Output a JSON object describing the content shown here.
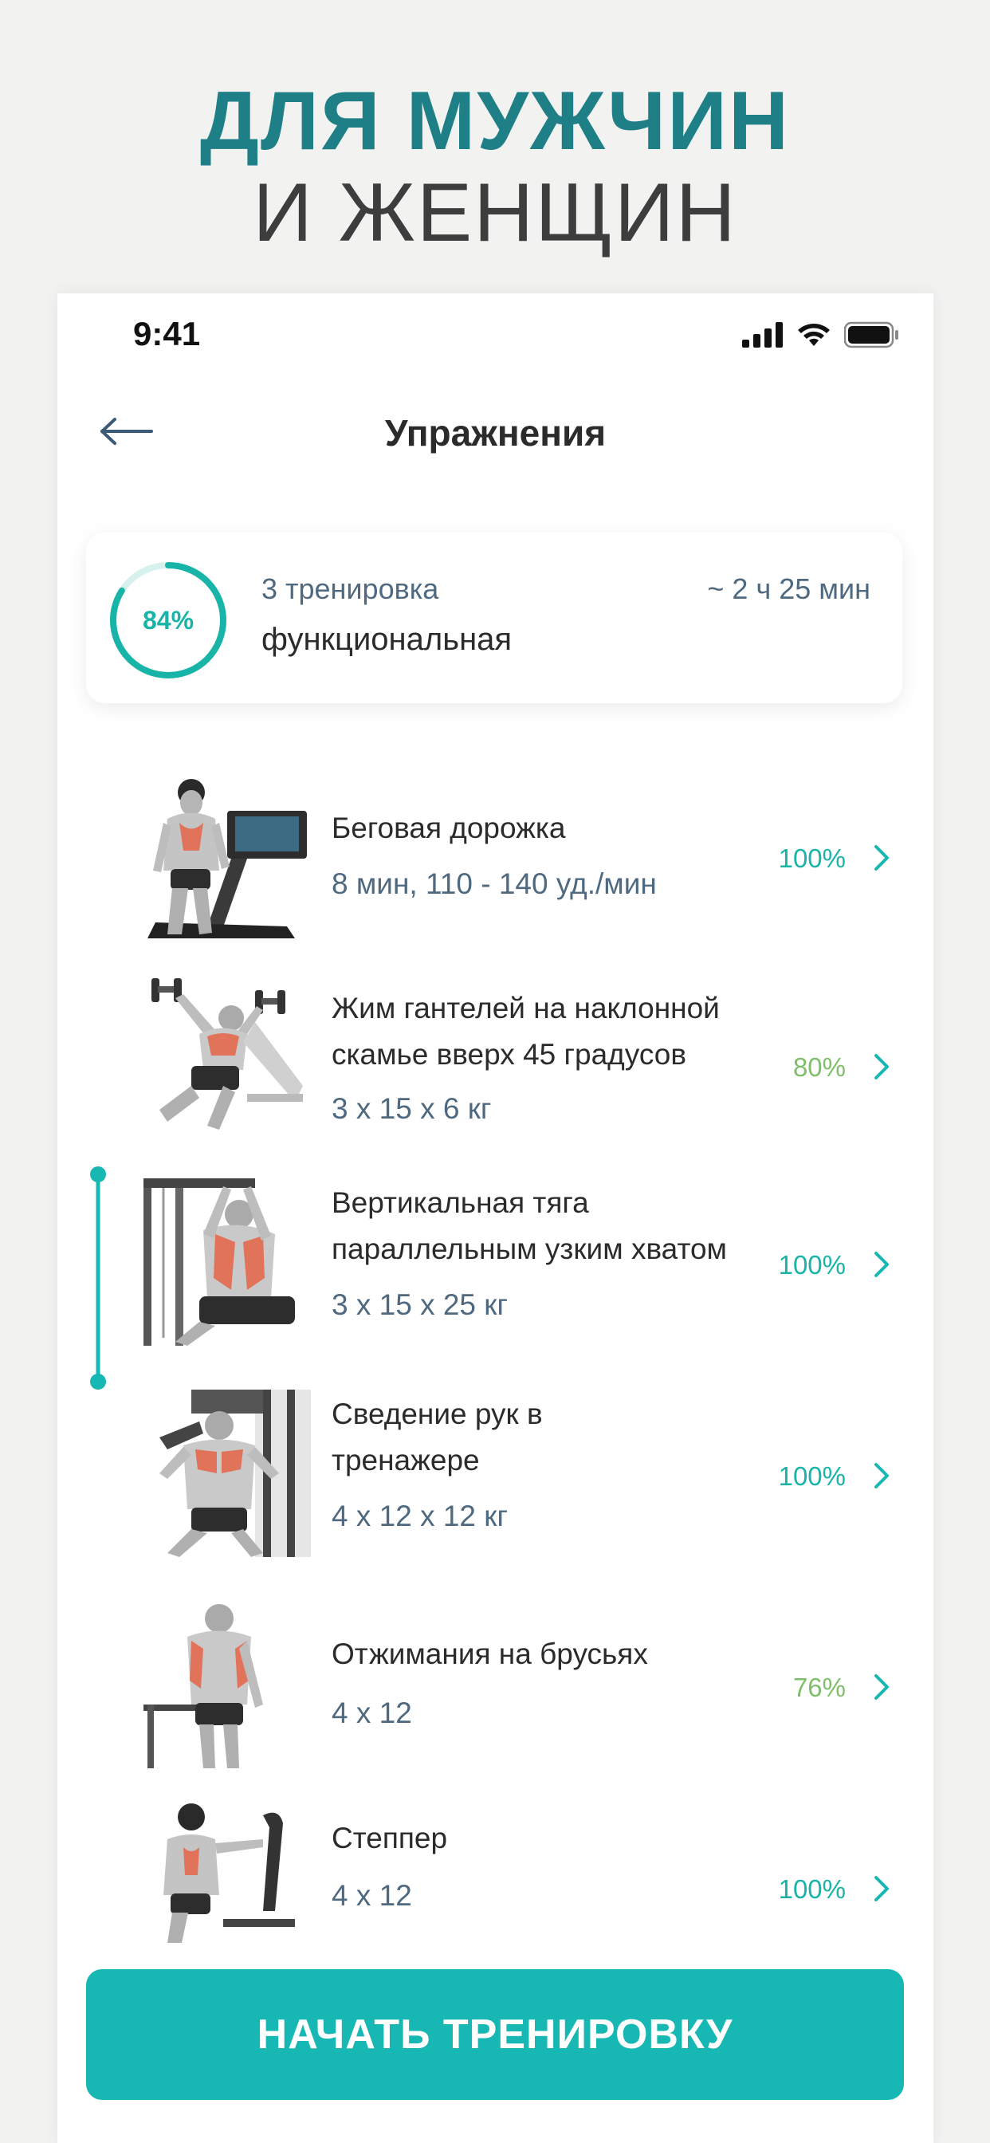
{
  "promo": {
    "line1": "ДЛЯ МУЖЧИН",
    "line2": "И ЖЕНЩИН"
  },
  "status_bar": {
    "time": "9:41"
  },
  "nav": {
    "title": "Упражнения"
  },
  "summary": {
    "progress_percent": 84,
    "progress_label": "84%",
    "workout_number": "3 тренировка",
    "duration": "~ 2 ч 25 мин",
    "workout_name": "функциональная"
  },
  "exercises": [
    {
      "name_lines": [
        "Беговая дорожка"
      ],
      "detail": "8 мин, 110 - 140 уд./мин",
      "percent": "100%",
      "image": "treadmill-illustration"
    },
    {
      "name_lines": [
        "Жим гантелей на наклонной",
        "скамье вверх 45 градусов"
      ],
      "detail": "3 x 15 x 6 кг",
      "percent": "80%",
      "image": "incline-dumbbell-press-illustration"
    },
    {
      "name_lines": [
        "Вертикальная тяга",
        "параллельным узким хватом"
      ],
      "detail": "3 x 15 x 25 кг",
      "percent": "100%",
      "image": "lat-pulldown-illustration"
    },
    {
      "name_lines": [
        "Сведение рук в",
        "тренажере"
      ],
      "detail": "4 x 12 x 12 кг",
      "percent": "100%",
      "image": "chest-fly-machine-illustration"
    },
    {
      "name_lines": [
        "Отжимания на брусьях"
      ],
      "detail": "4 x 12",
      "percent": "76%",
      "image": "parallel-bar-dips-illustration"
    },
    {
      "name_lines": [
        "Степпер"
      ],
      "detail": "4 x 12",
      "percent": "100%",
      "image": "stepper-illustration"
    }
  ],
  "cta": {
    "label": "НАЧАТЬ ТРЕНИРОВКУ"
  },
  "colors": {
    "teal": "#17b8b4",
    "headline_teal": "#1f7f86",
    "percent_full": "#19b4a8",
    "percent_partial": "#7fbf6a",
    "secondary_text": "#4f6a80"
  }
}
